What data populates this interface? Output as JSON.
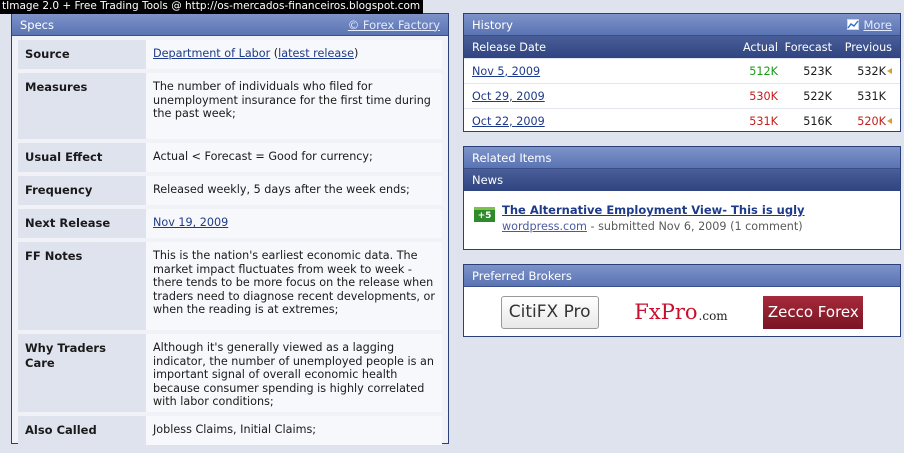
{
  "watermark": "tImage 2.0 + Free Trading Tools @ http://os-mercados-financeiros.blogspot.com",
  "specs": {
    "title": "Specs",
    "credit": "© Forex Factory",
    "source_label": "Source",
    "source_link": "Department of Labor",
    "source_open": "(",
    "source_link2": "latest release",
    "source_close": ")",
    "rows": [
      {
        "label": "Measures",
        "value": "The number of individuals who filed for unemployment insurance for the first time during the past week;"
      },
      {
        "label": "Usual Effect",
        "value": "Actual < Forecast = Good for currency;"
      },
      {
        "label": "Frequency",
        "value": "Released weekly, 5 days after the week ends;"
      },
      {
        "label": "Next Release",
        "value": "Nov 19, 2009"
      },
      {
        "label": "FF Notes",
        "value": "This is the nation's earliest economic data. The market impact fluctuates from week to week - there tends to be more focus on the release when traders need to diagnose recent developments, or when the reading is at extremes;"
      },
      {
        "label": "Why Traders Care",
        "value": "Although it's generally viewed as a lagging indicator, the number of unemployed people is an important signal of overall economic health because consumer spending is highly correlated with labor conditions;"
      },
      {
        "label": "Also Called",
        "value": "Jobless Claims, Initial Claims;"
      }
    ]
  },
  "history": {
    "title": "History",
    "more": "More",
    "columns": [
      "Release Date",
      "Actual",
      "Forecast",
      "Previous"
    ],
    "rows": [
      {
        "date": "Nov 5, 2009",
        "actual": "512K",
        "forecast": "523K",
        "previous": "532K"
      },
      {
        "date": "Oct 29, 2009",
        "actual": "530K",
        "forecast": "522K",
        "previous": "531K"
      },
      {
        "date": "Oct 22, 2009",
        "actual": "531K",
        "forecast": "516K",
        "previous": "520K"
      }
    ]
  },
  "related": {
    "title": "Related Items",
    "subtitle": "News",
    "badge": "+5",
    "news_title": "The Alternative Employment View- This is ugly",
    "news_source": "wordpress.com",
    "news_meta": " - submitted Nov 6, 2009 (1 comment)"
  },
  "brokers": {
    "title": "Preferred Brokers",
    "citifx": "CitiFX Pro",
    "fxpro": "FxPro",
    "fxpro_suffix": ".com",
    "zecco": "Zecco Forex"
  },
  "colors": {
    "positive": "#1a9a1a",
    "negative": "#c0201b",
    "header": "#5a74b4"
  }
}
